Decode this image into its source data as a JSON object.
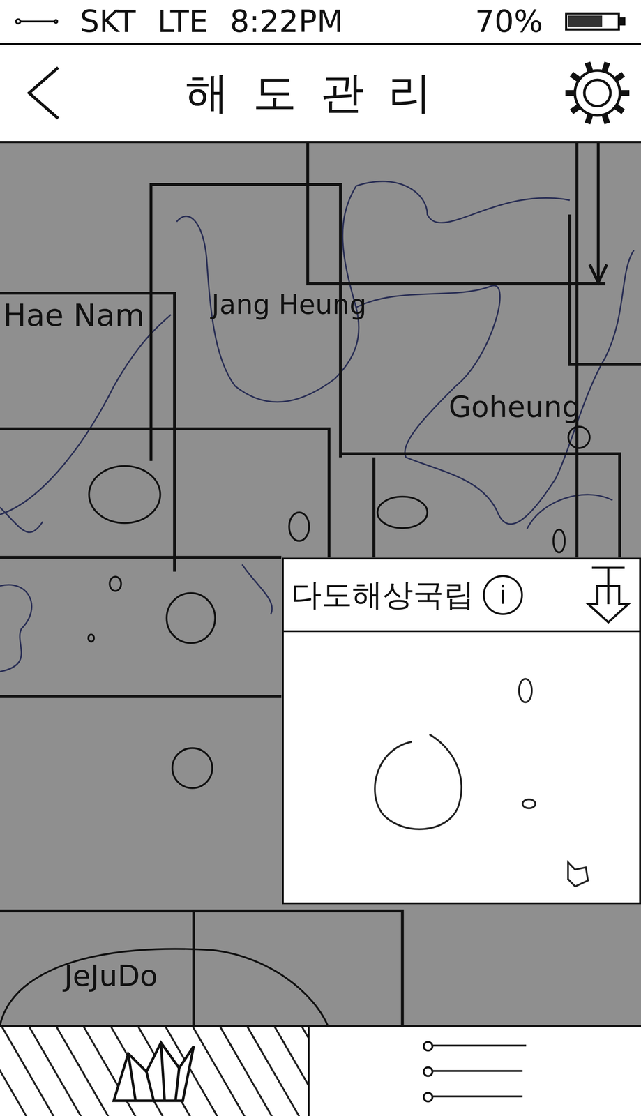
{
  "status_bar": {
    "carrier": "SKT",
    "network": "LTE",
    "time": "8:22PM",
    "battery": "70%",
    "battery_level": 0.7
  },
  "header": {
    "title": "해도관리"
  },
  "map": {
    "regions": [
      {
        "name": "Hae Nam"
      },
      {
        "name": "Jang Heung"
      },
      {
        "name": "Goheung"
      },
      {
        "name": "JeJuDo"
      }
    ]
  },
  "popup": {
    "title": "다도해상국립",
    "info": "i"
  },
  "bottom_tabs": [
    {
      "kind": "map",
      "selected": true
    },
    {
      "kind": "list",
      "selected": false
    }
  ]
}
